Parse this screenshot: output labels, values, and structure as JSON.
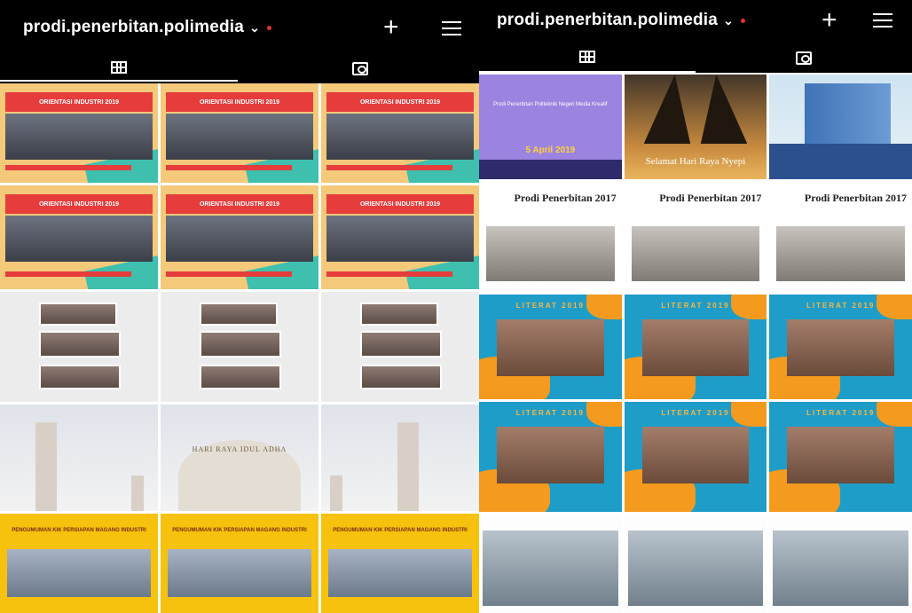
{
  "account": {
    "username": "prodi.penerbitan.polimedia"
  },
  "icons": {
    "dropdown": "chevron-down-icon",
    "new_post": "plus-icon",
    "menu": "hamburger-menu-icon",
    "grid_tab": "grid-icon",
    "tagged_tab": "tagged-photos-icon"
  },
  "colors": {
    "topbar_bg": "#000000",
    "notification_dot": "#e3342f"
  },
  "left_grid": {
    "orientation_banner": "ORIENTASI INDUSTRI 2019",
    "eid_caption": "HARI RAYA IDUL ADHA",
    "webinar_heading": "PENGUMUMAN KIK PERSIAPAN MAGANG INDUSTRI"
  },
  "right_grid": {
    "nyepi_caption": "Selamat Hari Raya Nyepi",
    "purple_date": "5 April 2019",
    "prodi_title": "Prodi Penerbitan 2017",
    "litbday_heading": "LITERAT 2019"
  }
}
